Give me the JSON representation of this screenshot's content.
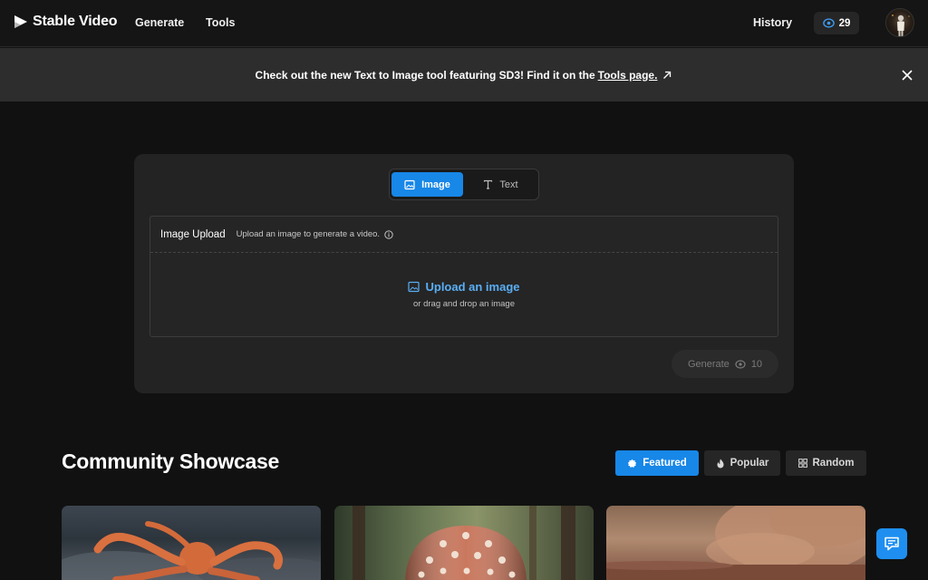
{
  "nav": {
    "logo_text": "Stable Video",
    "links": [
      "Generate",
      "Tools"
    ],
    "history_label": "History",
    "credits": "29"
  },
  "banner": {
    "text": "Check out the new Text to Image tool featuring SD3! Find it on the",
    "link_text": "Tools page."
  },
  "generator": {
    "tabs": [
      {
        "label": "Image",
        "active": true
      },
      {
        "label": "Text",
        "active": false
      }
    ],
    "upload_title": "Image Upload",
    "upload_hint": "Upload an image to generate a video.",
    "upload_link": "Upload an image",
    "upload_sub": "or drag and drop an image",
    "generate_label": "Generate",
    "generate_cost": "10"
  },
  "showcase": {
    "title": "Community Showcase",
    "filters": [
      {
        "label": "Featured",
        "active": true
      },
      {
        "label": "Popular",
        "active": false
      },
      {
        "label": "Random",
        "active": false
      }
    ],
    "cards": [
      {
        "subject": "octopus"
      },
      {
        "subject": "mushroom"
      },
      {
        "subject": "dust"
      }
    ]
  },
  "colors": {
    "accent": "#1787e8",
    "link": "#5aaef5",
    "background": "#111111",
    "panel": "#232323"
  }
}
